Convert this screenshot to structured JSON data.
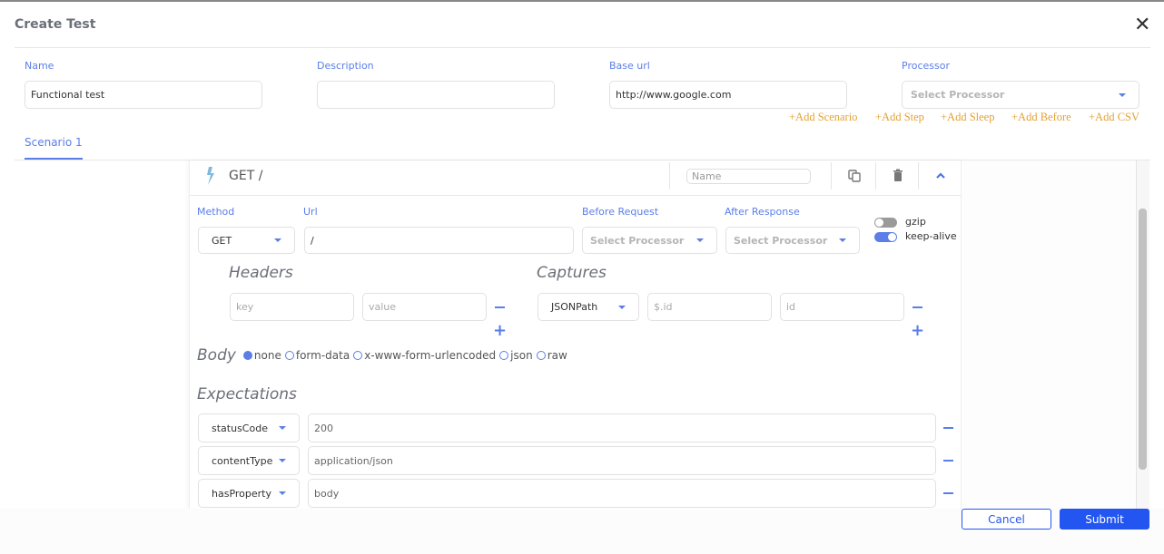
{
  "dialog": {
    "title": "Create Test",
    "close_icon": "close-icon"
  },
  "form": {
    "name": {
      "label": "Name",
      "value": "Functional test"
    },
    "description": {
      "label": "Description",
      "value": ""
    },
    "base_url": {
      "label": "Base url",
      "value": "http://www.google.com"
    },
    "processor": {
      "label": "Processor",
      "placeholder": "Select Processor"
    }
  },
  "actions": [
    "+Add Scenario",
    "+Add Step",
    "+Add Sleep",
    "+Add Before",
    "+Add CSV"
  ],
  "tabs": [
    {
      "label": "Scenario 1",
      "active": true
    }
  ],
  "step": {
    "title": "GET /",
    "name_placeholder": "Name",
    "icons": [
      "lightning-icon",
      "copy-icon",
      "trash-icon",
      "chevron-up-icon"
    ],
    "method": {
      "label": "Method",
      "value": "GET"
    },
    "url": {
      "label": "Url",
      "value": "/"
    },
    "before_request": {
      "label": "Before Request",
      "placeholder": "Select Processor"
    },
    "after_response": {
      "label": "After Response",
      "placeholder": "Select Processor"
    },
    "toggles": [
      {
        "label": "gzip",
        "on": false
      },
      {
        "label": "keep-alive",
        "on": true
      }
    ],
    "headers": {
      "title": "Headers",
      "rows": [
        {
          "key_placeholder": "key",
          "value_placeholder": "value"
        }
      ]
    },
    "captures": {
      "title": "Captures",
      "rows": [
        {
          "type": "JSONPath",
          "path_placeholder": "$.id",
          "name_placeholder": "id"
        }
      ]
    },
    "body": {
      "title": "Body",
      "options": [
        "none",
        "form-data",
        "x-www-form-urlencoded",
        "json",
        "raw"
      ],
      "selected": "none"
    },
    "expectations": {
      "title": "Expectations",
      "rows": [
        {
          "type": "statusCode",
          "value": "200"
        },
        {
          "type": "contentType",
          "value": "application/json"
        },
        {
          "type": "hasProperty",
          "value": "body"
        }
      ]
    }
  },
  "footer": {
    "cancel": "Cancel",
    "submit": "Submit"
  },
  "colors": {
    "accent": "#5b7ee8",
    "primary_button": "#2356f1",
    "link": "#e3a233"
  }
}
